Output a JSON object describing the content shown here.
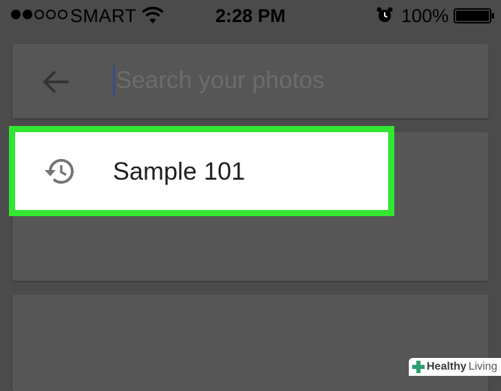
{
  "status_bar": {
    "carrier": "SMART",
    "signal_strength": 2,
    "signal_total": 5,
    "time": "2:28 PM",
    "battery_percent": "100%",
    "icons": [
      "wifi-icon",
      "alarm-clock-icon",
      "battery-icon"
    ]
  },
  "search": {
    "placeholder": "Search your photos",
    "back_icon": "arrow-left-icon"
  },
  "suggestions": [
    {
      "label": "Sample 101",
      "icon": "history-icon",
      "highlighted": true
    }
  ],
  "colors": {
    "highlight": "#32e632",
    "overlay_background": "#4b4b4b",
    "card_background": "#565656"
  },
  "watermark": {
    "brand_bold": "Healthy",
    "brand_light": "Living"
  }
}
